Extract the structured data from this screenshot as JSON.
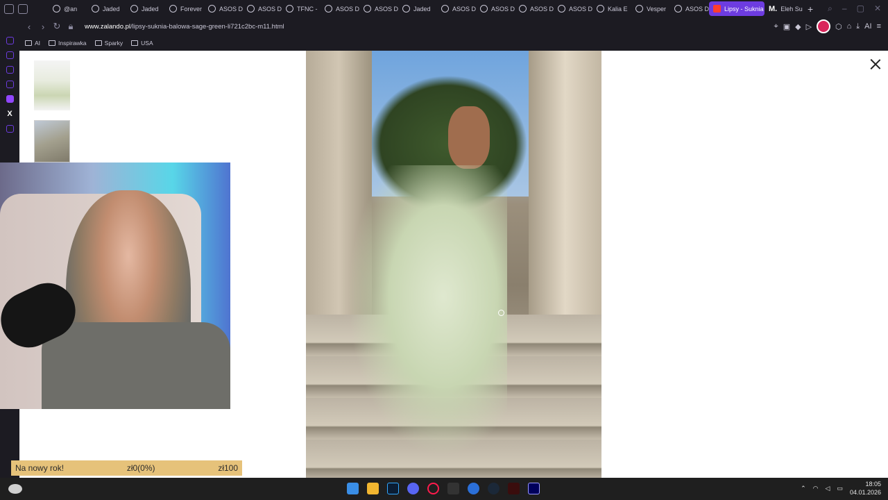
{
  "tabs": [
    {
      "label": "@an"
    },
    {
      "label": "Jaded"
    },
    {
      "label": "Jaded"
    },
    {
      "label": "Forever"
    },
    {
      "label": "ASOS D"
    },
    {
      "label": "ASOS D"
    },
    {
      "label": "TFNC -"
    },
    {
      "label": "ASOS D"
    },
    {
      "label": "ASOS D"
    },
    {
      "label": "Jaded"
    },
    {
      "label": "ASOS D"
    },
    {
      "label": "ASOS D"
    },
    {
      "label": "ASOS D"
    },
    {
      "label": "ASOS D"
    },
    {
      "label": "Kalia E"
    },
    {
      "label": "Vesper"
    },
    {
      "label": "ASOS D"
    },
    {
      "label": "Lipsy - Suknia",
      "active": true
    },
    {
      "label": "Eleh Su"
    }
  ],
  "address": {
    "domain": "www.zalando.pl",
    "path": "/lipsy-suknia-balowa-sage-green-li721c2bc-m11.html"
  },
  "bookmarks": [
    "AI",
    "Inspirawka",
    "Sparky",
    "USA"
  ],
  "goal": {
    "label": "Na nowy rok!",
    "progress": "zł0(0%)",
    "target": "zł100"
  },
  "taskbar": {
    "time": "18:05",
    "date": "04.01.2026"
  },
  "icons": {
    "close": "close-icon",
    "back": "back-arrow-icon",
    "forward": "forward-arrow-icon",
    "reload": "reload-icon",
    "lock": "lock-icon"
  }
}
